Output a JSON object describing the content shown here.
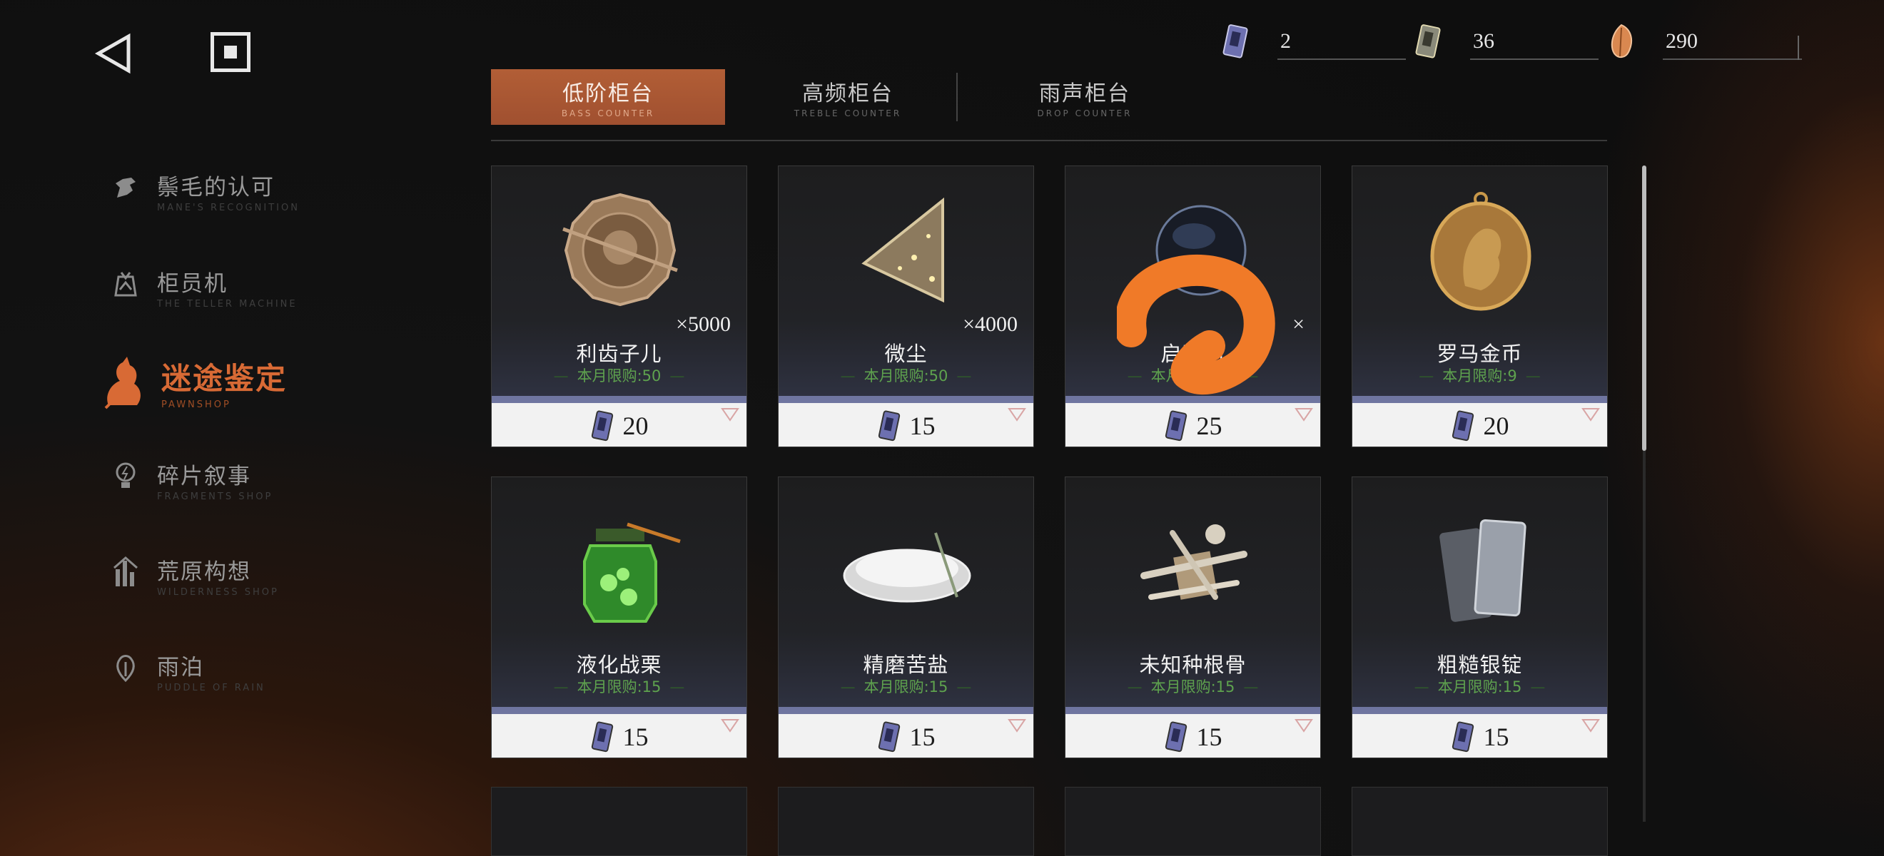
{
  "currencies": [
    {
      "icon": "tape-ticket-icon",
      "value": "2"
    },
    {
      "icon": "tape-ticket-gold-icon",
      "value": "36"
    },
    {
      "icon": "amber-drop-icon",
      "value": "290"
    }
  ],
  "sidebar": {
    "items": [
      {
        "zh": "鬃毛的认可",
        "en": "MANE'S RECOGNITION",
        "icon": "horse-head-icon"
      },
      {
        "zh": "柜员机",
        "en": "THE TELLER MACHINE",
        "icon": "teller-machine-icon"
      },
      {
        "zh": "迷途鉴定",
        "en": "PAWNSHOP",
        "icon": "pawnshop-rat-icon"
      },
      {
        "zh": "碎片叙事",
        "en": "FRAGMENTS SHOP",
        "icon": "lightbulb-icon"
      },
      {
        "zh": "荒原构想",
        "en": "WILDERNESS SHOP",
        "icon": "wilderness-tower-icon"
      },
      {
        "zh": "雨泊",
        "en": "PUDDLE OF RAIN",
        "icon": "raindrop-icon"
      }
    ]
  },
  "tabs": [
    {
      "zh": "低阶柜台",
      "en": "BASS COUNTER"
    },
    {
      "zh": "高频柜台",
      "en": "TREBLE COUNTER"
    },
    {
      "zh": "雨声柜台",
      "en": "DROP COUNTER"
    }
  ],
  "items": [
    {
      "name": "利齿子儿",
      "limit": "本月限购:50",
      "qty": "×5000",
      "price": "20",
      "icon": "tooth-coin-icon"
    },
    {
      "name": "微尘",
      "limit": "本月限购:50",
      "qty": "×4000",
      "price": "15",
      "icon": "dust-triangle-icon"
    },
    {
      "name": "启寤川",
      "limit": "本月限购:50",
      "qty": "×",
      "price": "25",
      "icon": "dark-orb-icon"
    },
    {
      "name": "罗马金币",
      "limit": "本月限购:9",
      "qty": "",
      "price": "20",
      "icon": "roman-gold-coin-icon"
    },
    {
      "name": "液化战栗",
      "limit": "本月限购:15",
      "qty": "",
      "price": "15",
      "icon": "green-jar-icon"
    },
    {
      "name": "精磨苦盐",
      "limit": "本月限购:15",
      "qty": "",
      "price": "15",
      "icon": "salt-bowl-icon"
    },
    {
      "name": "未知种根骨",
      "limit": "本月限购:15",
      "qty": "",
      "price": "15",
      "icon": "bones-icon"
    },
    {
      "name": "粗糙银锭",
      "limit": "本月限购:15",
      "qty": "",
      "price": "15",
      "icon": "silver-ingot-icon"
    }
  ],
  "colors": {
    "accent": "#d86a35",
    "tab_active": "#a85633",
    "limit_green": "#5ea24e",
    "price_band": "#6f75a0",
    "scribble": "#f07a28"
  }
}
